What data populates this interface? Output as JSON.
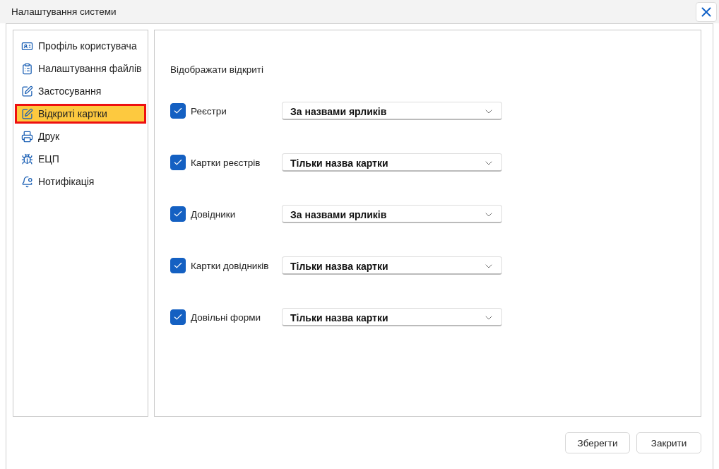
{
  "window": {
    "title": "Налаштування системи"
  },
  "sidebar": {
    "items": [
      {
        "label": "Профіль користувача",
        "selected": false
      },
      {
        "label": "Налаштування файлів",
        "selected": false
      },
      {
        "label": "Застосування",
        "selected": false
      },
      {
        "label": "Відкриті картки",
        "selected": true
      },
      {
        "label": "Друк",
        "selected": false
      },
      {
        "label": "ЕЦП",
        "selected": false
      },
      {
        "label": "Нотифікація",
        "selected": false
      }
    ]
  },
  "content": {
    "heading": "Відображати відкриті",
    "rows": [
      {
        "label": "Реєстри",
        "checked": true,
        "value": "За назвами ярликів"
      },
      {
        "label": "Картки реєстрів",
        "checked": true,
        "value": "Тільки назва картки"
      },
      {
        "label": "Довідники",
        "checked": true,
        "value": "За назвами ярликів"
      },
      {
        "label": "Картки довідників",
        "checked": true,
        "value": "Тільки назва картки"
      },
      {
        "label": "Довільні форми",
        "checked": true,
        "value": "Тільки назва картки"
      }
    ]
  },
  "buttons": [
    "Зберегти",
    "Закрити"
  ]
}
